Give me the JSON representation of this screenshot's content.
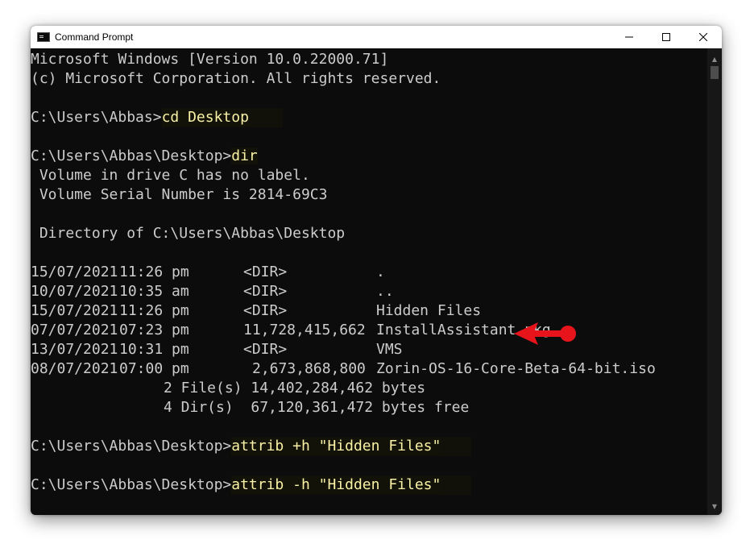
{
  "window": {
    "title": "Command Prompt",
    "minimize_glyph": "─",
    "maximize_glyph": "☐",
    "close_glyph": "✕"
  },
  "terminal": {
    "header": [
      "Microsoft Windows [Version 10.0.22000.71]",
      "(c) Microsoft Corporation. All rights reserved."
    ],
    "prompt1": "C:\\Users\\Abbas>",
    "cmd1": "cd Desktop",
    "prompt2": "C:\\Users\\Abbas\\Desktop>",
    "cmd2": "dir",
    "volume_label": " Volume in drive C has no label.",
    "volume_serial": " Volume Serial Number is 2814-69C3",
    "directory_of": " Directory of C:\\Users\\Abbas\\Desktop",
    "listing": [
      {
        "date": "15/07/2021",
        "time": "11:26 pm",
        "size": "<DIR>",
        "name": "."
      },
      {
        "date": "10/07/2021",
        "time": "10:35 am",
        "size": "<DIR>",
        "name": ".."
      },
      {
        "date": "15/07/2021",
        "time": "11:26 pm",
        "size": "<DIR>",
        "name": "Hidden Files"
      },
      {
        "date": "07/07/2021",
        "time": "07:23 pm",
        "size": "11,728,415,662",
        "name": "InstallAssistant.pkg"
      },
      {
        "date": "13/07/2021",
        "time": "10:31 pm",
        "size": "<DIR>",
        "name": "VMS"
      },
      {
        "date": "08/07/2021",
        "time": "07:00 pm",
        "size": "2,673,868,800",
        "name": "Zorin-OS-16-Core-Beta-64-bit.iso"
      }
    ],
    "summary_files": "2 File(s) 14,402,284,462 bytes",
    "summary_dirs": "4 Dir(s)  67,120,361,472 bytes free",
    "prompt3": "C:\\Users\\Abbas\\Desktop>",
    "cmd3": "attrib +h \"Hidden Files\"",
    "prompt4": "C:\\Users\\Abbas\\Desktop>",
    "cmd4": "attrib -h \"Hidden Files\""
  },
  "colors": {
    "background": "#0c0c0c",
    "text": "#cccccc",
    "command_text": "#f9f1a5",
    "annotation_arrow": "#e8141b"
  },
  "annotation": {
    "icon": "red-arrow-icon"
  }
}
